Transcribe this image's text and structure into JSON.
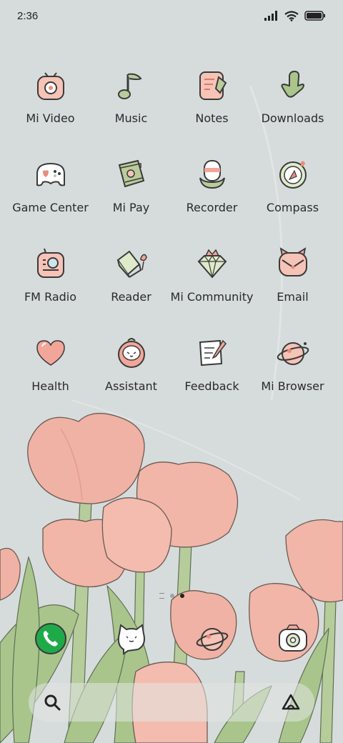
{
  "status_bar": {
    "time": "2:36"
  },
  "apps": [
    {
      "label": "Mi Video",
      "icon": "video-icon"
    },
    {
      "label": "Music",
      "icon": "music-note-icon"
    },
    {
      "label": "Notes",
      "icon": "notes-icon"
    },
    {
      "label": "Downloads",
      "icon": "download-icon"
    },
    {
      "label": "Game Center",
      "icon": "gamepad-icon"
    },
    {
      "label": "Mi Pay",
      "icon": "wallet-icon"
    },
    {
      "label": "Recorder",
      "icon": "recorder-icon"
    },
    {
      "label": "Compass",
      "icon": "compass-icon"
    },
    {
      "label": "FM Radio",
      "icon": "radio-icon"
    },
    {
      "label": "Reader",
      "icon": "book-icon"
    },
    {
      "label": "Mi Community",
      "icon": "diamond-icon"
    },
    {
      "label": "Email",
      "icon": "email-icon"
    },
    {
      "label": "Health",
      "icon": "heart-icon"
    },
    {
      "label": "Assistant",
      "icon": "assistant-icon"
    },
    {
      "label": "Feedback",
      "icon": "feedback-icon"
    },
    {
      "label": "Mi Browser",
      "icon": "planet-icon"
    }
  ],
  "pager": {
    "pages": 2,
    "active": 2
  },
  "dock": [
    {
      "name": "phone",
      "icon": "phone-icon",
      "color": "#1faa4a"
    },
    {
      "name": "messaging",
      "icon": "cat-chat-icon"
    },
    {
      "name": "browser",
      "icon": "planet-icon"
    },
    {
      "name": "camera",
      "icon": "camera-icon"
    }
  ],
  "colors": {
    "icon_pink": "#f2b8ae",
    "icon_green": "#b9cc9a",
    "outline": "#3a3a3a",
    "petal": "#f1b3a6",
    "leaf": "#a9c58c"
  }
}
